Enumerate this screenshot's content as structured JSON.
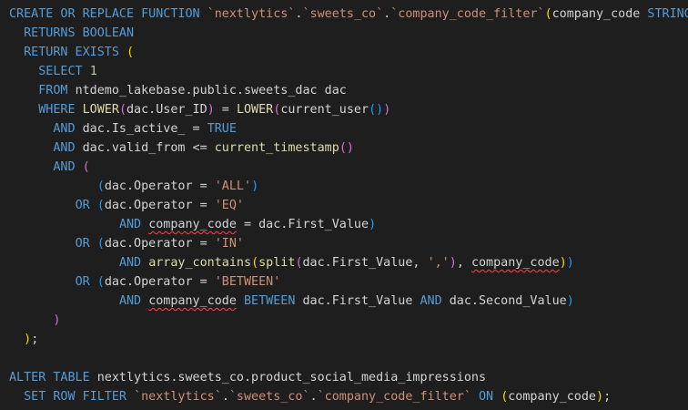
{
  "editor": {
    "language": "sql",
    "theme": {
      "background": "#1e1e1e",
      "keyword": "#569cd6",
      "string": "#ce9178",
      "function": "#dcdcaa",
      "identifier": "#9cdcfe",
      "number": "#b5cea8",
      "bracket_level_1": "#ffd700",
      "bracket_level_2": "#da70d6",
      "bracket_level_3": "#179fff",
      "error_squiggle": "#f14c4c"
    },
    "lines": [
      [
        [
          "k",
          "CREATE OR REPLACE FUNCTION "
        ],
        [
          "s",
          "`nextlytics`"
        ],
        [
          "t",
          "."
        ],
        [
          "s",
          "`sweets_co`"
        ],
        [
          "t",
          "."
        ],
        [
          "s",
          "`company_code_filter`"
        ],
        [
          "p1",
          "("
        ],
        [
          "t",
          "company_code "
        ],
        [
          "k",
          "STRING"
        ],
        [
          "p1",
          ")"
        ]
      ],
      [
        [
          "t",
          "  "
        ],
        [
          "k",
          "RETURNS BOOLEAN"
        ]
      ],
      [
        [
          "t",
          "  "
        ],
        [
          "k",
          "RETURN EXISTS "
        ],
        [
          "p1",
          "("
        ]
      ],
      [
        [
          "t",
          "    "
        ],
        [
          "k",
          "SELECT "
        ],
        [
          "n",
          "1"
        ]
      ],
      [
        [
          "t",
          "    "
        ],
        [
          "k",
          "FROM "
        ],
        [
          "t",
          "ntdemo_lakebase.public.sweets_dac dac"
        ]
      ],
      [
        [
          "t",
          "    "
        ],
        [
          "k",
          "WHERE "
        ],
        [
          "f",
          "LOWER"
        ],
        [
          "p2",
          "("
        ],
        [
          "t",
          "dac.User_ID"
        ],
        [
          "p2",
          ")"
        ],
        [
          "t",
          " = "
        ],
        [
          "f",
          "LOWER"
        ],
        [
          "p2",
          "("
        ],
        [
          "t",
          "current_user"
        ],
        [
          "p3",
          "()"
        ],
        [
          "p2",
          ")"
        ]
      ],
      [
        [
          "t",
          "      "
        ],
        [
          "k",
          "AND "
        ],
        [
          "t",
          "dac.Is_active_ = "
        ],
        [
          "k",
          "TRUE"
        ]
      ],
      [
        [
          "t",
          "      "
        ],
        [
          "k",
          "AND "
        ],
        [
          "t",
          "dac.valid_from <= "
        ],
        [
          "f",
          "current_timestamp"
        ],
        [
          "p2",
          "()"
        ]
      ],
      [
        [
          "t",
          "      "
        ],
        [
          "k",
          "AND "
        ],
        [
          "p2",
          "("
        ]
      ],
      [
        [
          "t",
          "            "
        ],
        [
          "p3",
          "("
        ],
        [
          "t",
          "dac.Operator = "
        ],
        [
          "s",
          "'ALL'"
        ],
        [
          "p3",
          ")"
        ]
      ],
      [
        [
          "t",
          "         "
        ],
        [
          "k",
          "OR "
        ],
        [
          "p3",
          "("
        ],
        [
          "t",
          "dac.Operator = "
        ],
        [
          "s",
          "'EQ'"
        ]
      ],
      [
        [
          "t",
          "               "
        ],
        [
          "k",
          "AND "
        ],
        [
          "sq",
          "company_code"
        ],
        [
          "t",
          " = dac.First_Value"
        ],
        [
          "p3",
          ")"
        ]
      ],
      [
        [
          "t",
          "         "
        ],
        [
          "k",
          "OR "
        ],
        [
          "p3",
          "("
        ],
        [
          "t",
          "dac.Operator = "
        ],
        [
          "s",
          "'IN'"
        ]
      ],
      [
        [
          "t",
          "               "
        ],
        [
          "k",
          "AND "
        ],
        [
          "f",
          "array_contains"
        ],
        [
          "p1",
          "("
        ],
        [
          "f",
          "split"
        ],
        [
          "p2",
          "("
        ],
        [
          "t",
          "dac.First_Value, "
        ],
        [
          "s",
          "','"
        ],
        [
          "p2",
          ")"
        ],
        [
          "t",
          ", "
        ],
        [
          "sq",
          "company_code"
        ],
        [
          "p1",
          ")"
        ],
        [
          "p3",
          ")"
        ]
      ],
      [
        [
          "t",
          "         "
        ],
        [
          "k",
          "OR "
        ],
        [
          "p3",
          "("
        ],
        [
          "t",
          "dac.Operator = "
        ],
        [
          "s",
          "'BETWEEN'"
        ]
      ],
      [
        [
          "t",
          "               "
        ],
        [
          "k",
          "AND "
        ],
        [
          "sq",
          "company_code"
        ],
        [
          "t",
          " "
        ],
        [
          "k",
          "BETWEEN "
        ],
        [
          "t",
          "dac.First_Value "
        ],
        [
          "k",
          "AND "
        ],
        [
          "t",
          "dac.Second_Value"
        ],
        [
          "p3",
          ")"
        ]
      ],
      [
        [
          "t",
          "      "
        ],
        [
          "p2",
          ")"
        ]
      ],
      [
        [
          "t",
          "  "
        ],
        [
          "p1",
          ")"
        ],
        [
          "t",
          ";"
        ]
      ],
      [],
      [
        [
          "k",
          "ALTER TABLE "
        ],
        [
          "t",
          "nextlytics.sweets_co.product_social_media_impressions"
        ]
      ],
      [
        [
          "t",
          "  "
        ],
        [
          "k",
          "SET ROW FILTER "
        ],
        [
          "s",
          "`nextlytics`"
        ],
        [
          "t",
          "."
        ],
        [
          "s",
          "`sweets_co`"
        ],
        [
          "t",
          "."
        ],
        [
          "s",
          "`company_code_filter`"
        ],
        [
          "t",
          " "
        ],
        [
          "k",
          "ON "
        ],
        [
          "p1",
          "("
        ],
        [
          "t",
          "company_code"
        ],
        [
          "p1",
          ")"
        ],
        [
          "t",
          ";"
        ]
      ]
    ]
  }
}
